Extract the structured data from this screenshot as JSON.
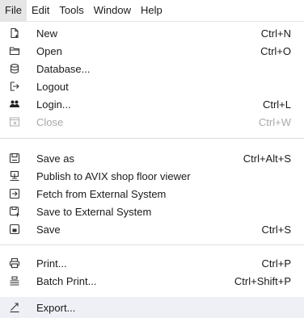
{
  "menubar": {
    "items": [
      {
        "label": "File"
      },
      {
        "label": "Edit"
      },
      {
        "label": "Tools"
      },
      {
        "label": "Window"
      },
      {
        "label": "Help"
      }
    ]
  },
  "file_menu": {
    "items": [
      {
        "label": "New",
        "shortcut": "Ctrl+N",
        "icon": "new-file-icon"
      },
      {
        "label": "Open",
        "shortcut": "Ctrl+O",
        "icon": "folder-open-icon"
      },
      {
        "label": "Database...",
        "shortcut": "",
        "icon": "database-icon"
      },
      {
        "label": "Logout",
        "shortcut": "",
        "icon": "logout-icon"
      },
      {
        "label": "Login...",
        "shortcut": "Ctrl+L",
        "icon": "users-icon"
      },
      {
        "label": "Close",
        "shortcut": "Ctrl+W",
        "icon": "close-document-icon",
        "disabled": true
      },
      {
        "label": "Save as",
        "shortcut": "Ctrl+Alt+S",
        "icon": "save-as-icon"
      },
      {
        "label": "Publish to AVIX shop floor viewer",
        "shortcut": "",
        "icon": "publish-icon"
      },
      {
        "label": "Fetch from External System",
        "shortcut": "",
        "icon": "fetch-icon"
      },
      {
        "label": "Save to External System",
        "shortcut": "",
        "icon": "save-external-icon"
      },
      {
        "label": "Save",
        "shortcut": "Ctrl+S",
        "icon": "save-icon"
      },
      {
        "label": "Print...",
        "shortcut": "Ctrl+P",
        "icon": "printer-icon"
      },
      {
        "label": "Batch Print...",
        "shortcut": "Ctrl+Shift+P",
        "icon": "batch-print-icon"
      },
      {
        "label": "Export...",
        "shortcut": "",
        "icon": "export-icon"
      }
    ]
  }
}
